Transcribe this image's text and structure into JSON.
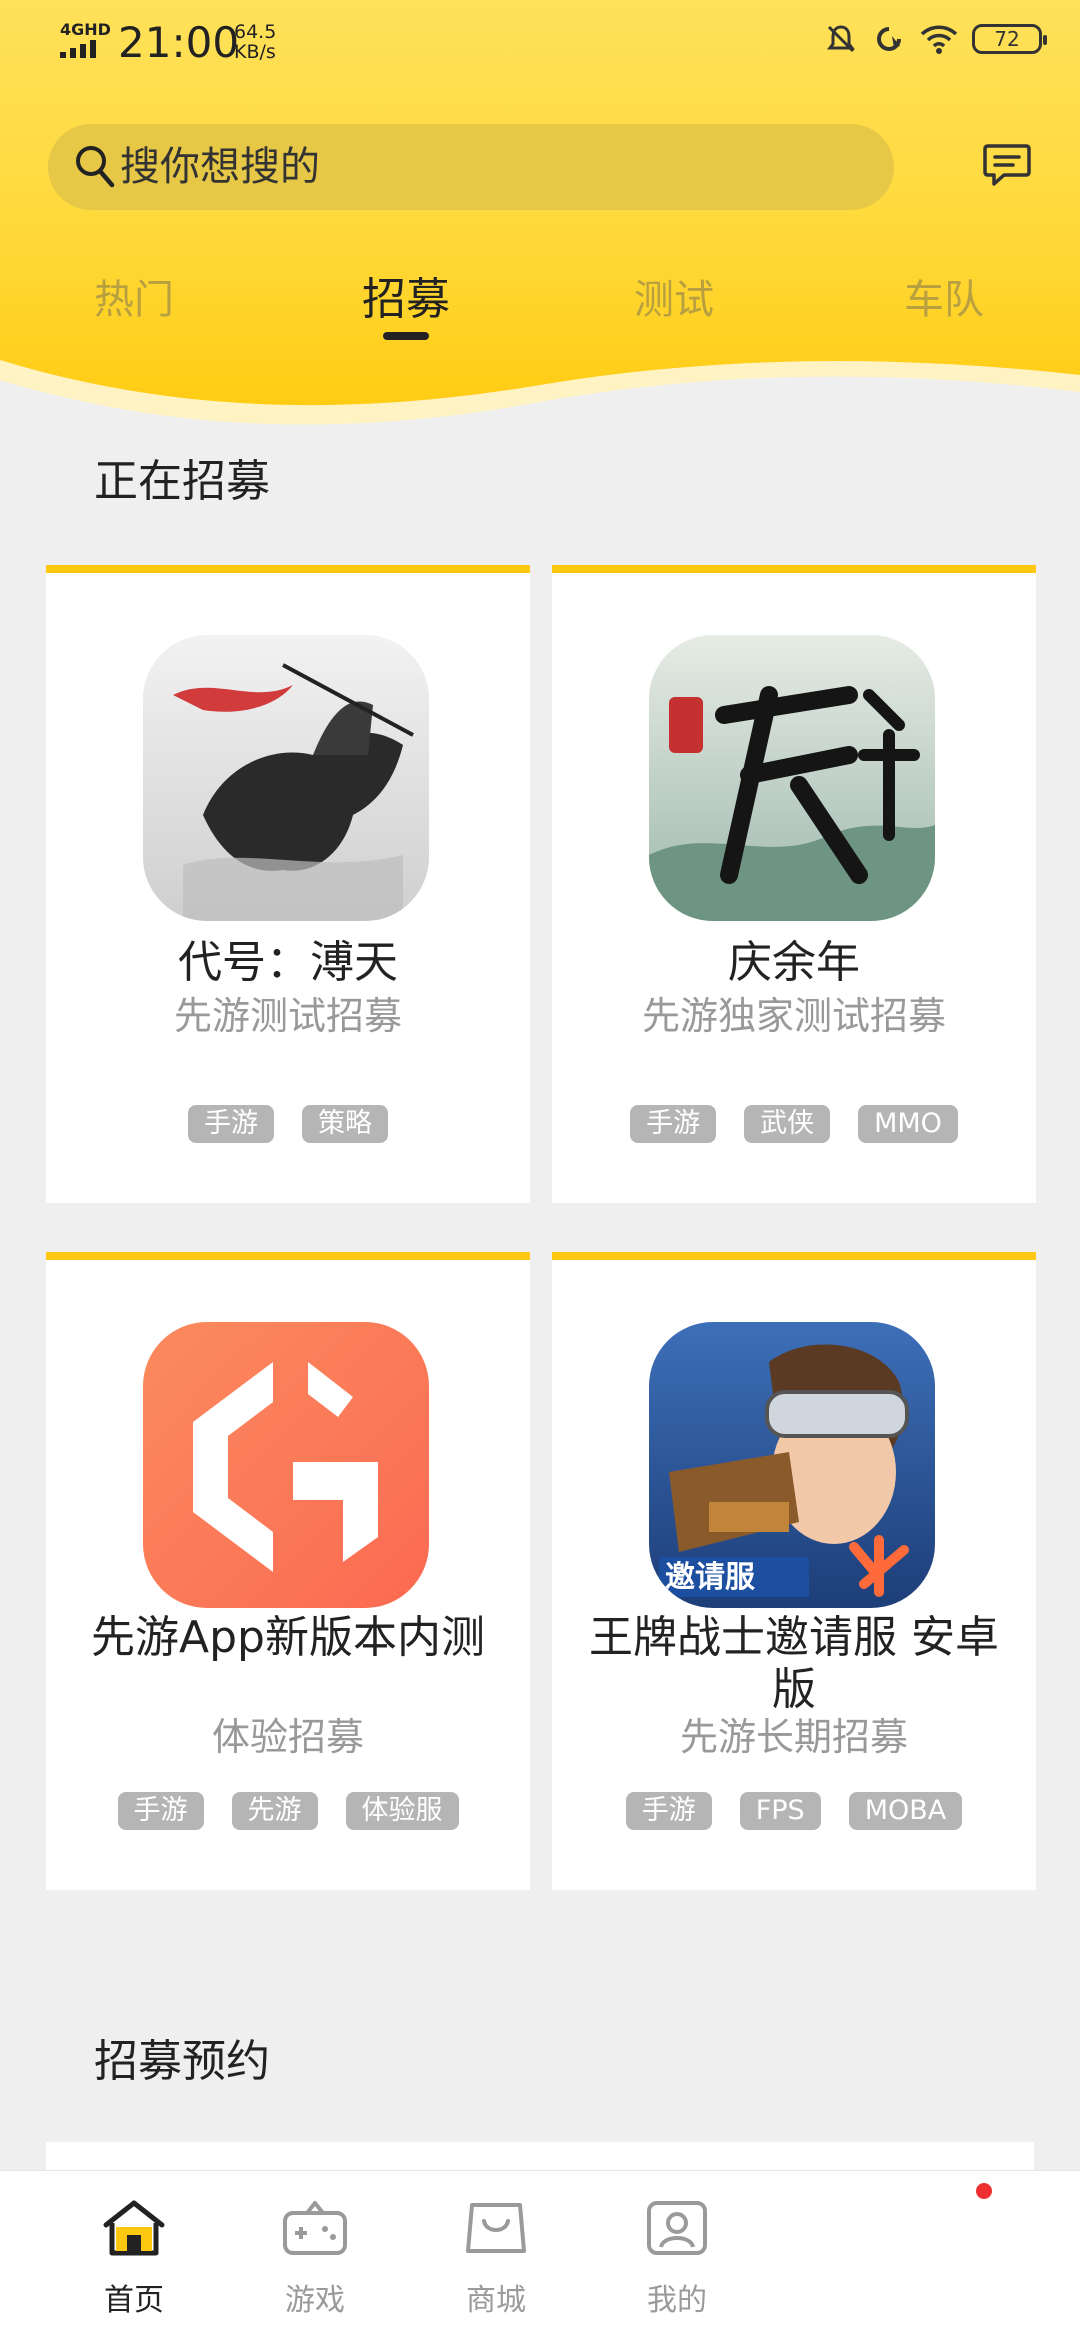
{
  "status_bar": {
    "network": "4GHD",
    "time": "21:00",
    "speed_value": "64.5",
    "speed_unit": "KB/s",
    "battery": "72",
    "icons": [
      "mute-icon",
      "sync-icon",
      "wifi-icon",
      "battery-icon"
    ]
  },
  "search": {
    "placeholder": "搜你想搜的"
  },
  "tabs": [
    {
      "label": "热门",
      "active": false
    },
    {
      "label": "招募",
      "active": true
    },
    {
      "label": "测试",
      "active": false
    },
    {
      "label": "车队",
      "active": false
    }
  ],
  "sections": {
    "recruiting_title": "正在招募",
    "reservation_title": "招募预约"
  },
  "cards": [
    {
      "title": "代号：溥天",
      "subtitle": "先游测试招募",
      "tags": [
        "手游",
        "策略"
      ],
      "icon": "horse-ink-art-icon"
    },
    {
      "title": "庆余年",
      "subtitle": "先游独家测试招募",
      "tags": [
        "手游",
        "武侠",
        "MMO"
      ],
      "icon": "qingyunian-calligraphy-icon"
    },
    {
      "title": "先游App新版本内测",
      "subtitle": "体验招募",
      "tags": [
        "手游",
        "先游",
        "体验服"
      ],
      "icon": "xianyou-logo-icon"
    },
    {
      "title": "王牌战士邀请服 安卓版",
      "subtitle": "先游长期招募",
      "tags": [
        "手游",
        "FPS",
        "MOBA"
      ],
      "icon": "ace-warrior-character-icon"
    }
  ],
  "bottom_nav": [
    {
      "label": "首页",
      "icon": "home-icon",
      "active": true
    },
    {
      "label": "游戏",
      "icon": "gamepad-icon",
      "active": false
    },
    {
      "label": "商城",
      "icon": "shop-bag-icon",
      "active": false
    },
    {
      "label": "我的",
      "icon": "profile-icon",
      "active": false,
      "badge": true
    }
  ],
  "colors": {
    "accent": "#ffc810",
    "header_yellow": "#ffd93a",
    "search_bg": "#e6c746",
    "tag_bg": "#b5b5b5",
    "badge_red": "#f03030"
  }
}
